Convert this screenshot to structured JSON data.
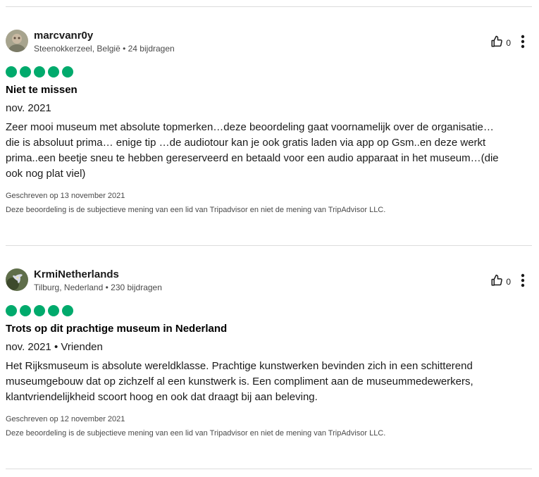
{
  "reviews": [
    {
      "user": {
        "name": "marcvanr0y",
        "location": "Steenokkerzeel, België",
        "contributions": "24 bijdragen"
      },
      "likes": "0",
      "rating": 5,
      "title": "Niet te missen",
      "date": "nov. 2021",
      "trip_type": "",
      "body": "Zeer mooi museum met absolute topmerken…deze beoordeling gaat voornamelijk over de organisatie…die is absoluut prima… enige tip …de audiotour kan je ook gratis laden via app op Gsm..en deze werkt prima..een beetje sneu te hebben gereserveerd en betaald voor een audio apparaat in het museum…(die ook nog plat viel)",
      "written": "Geschreven op 13 november 2021",
      "disclaimer": "Deze beoordeling is de subjectieve mening van een lid van Tripadvisor en niet de mening van TripAdvisor LLC."
    },
    {
      "user": {
        "name": "KrmiNetherlands",
        "location": "Tilburg, Nederland",
        "contributions": "230 bijdragen"
      },
      "likes": "0",
      "rating": 5,
      "title": "Trots op dit prachtige museum in Nederland",
      "date": "nov. 2021",
      "trip_type": "Vrienden",
      "body": "Het Rijksmuseum is absolute wereldklasse. Prachtige kunstwerken bevinden zich in een schitterend museumgebouw dat op zichzelf al een kunstwerk is. Een compliment aan de museummedewerkers, klantvriendelijkheid scoort hoog en ook dat draagt bij aan beleving.",
      "written": "Geschreven op 12 november 2021",
      "disclaimer": "Deze beoordeling is de subjectieve mening van een lid van Tripadvisor en niet de mening van TripAdvisor LLC."
    }
  ],
  "separator": " • ",
  "colors": {
    "bubble": "#00aa6c",
    "divider": "#dcdcdc",
    "text": "#1a1a1a",
    "muted": "#4a4a4a"
  },
  "icons": [
    "thumbs-up-icon",
    "more-vertical-icon"
  ]
}
